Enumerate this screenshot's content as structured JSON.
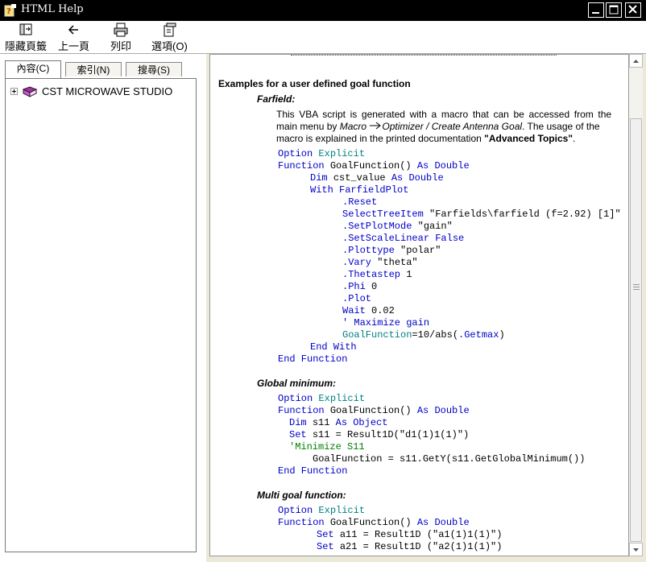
{
  "window": {
    "title": "HTML Help"
  },
  "toolbar": {
    "hide_tabs": "隱藏頁籤",
    "back": "上一頁",
    "print": "列印",
    "options": "選項(O)"
  },
  "tabs": {
    "contents": "內容(C)",
    "index": "索引(N)",
    "search": "搜尋(S)"
  },
  "tree": {
    "root": "CST MICROWAVE STUDIO"
  },
  "doc": {
    "heading": "Examples for a user defined goal function",
    "farfield": {
      "title": "Farfield:",
      "p1": "This VBA script is generated with a macro that can be accessed from the",
      "p2_pre": "main menu by ",
      "p2_macro": "Macro",
      "p2_path": "Optimizer / Create Antenna Goal",
      "p2_post": ". The usage of the",
      "p3_pre": "macro is explained in the printed documentation ",
      "p3_bold": "\"Advanced Topics\"",
      "p3_post": ".",
      "code": {
        "option": "Option",
        "explicit": "Explicit",
        "function": "Function",
        "func_name": "GoalFunction()",
        "as": "As",
        "double": "Double",
        "dim": "Dim",
        "cst_value": "cst_value",
        "with": "With",
        "farfieldplot": "FarfieldPlot",
        "reset": ".Reset",
        "selecttreeitem": "SelectTreeItem",
        "selecttreeitem_arg": "\"Farfields\\farfield (f=2.92) [1]\"",
        "setplotmode": ".SetPlotMode",
        "setplotmode_arg": "\"gain\"",
        "setscalelinear": ".SetScaleLinear",
        "false": "False",
        "plottype": ".Plottype",
        "plottype_arg": "\"polar\"",
        "vary": ".Vary",
        "vary_arg": "\"theta\"",
        "thetastep": ".Thetastep",
        "thetastep_arg": "1",
        "phi": ".Phi",
        "phi_arg": "0",
        "plot": ".Plot",
        "wait": "Wait",
        "wait_arg": "0.02",
        "comment": "' Maximize gain",
        "goal_assign": "GoalFunction",
        "goal_expr_a": "=10/abs(",
        "getmax": ".Getmax",
        "goal_expr_b": ")",
        "end_with": "End With",
        "end_function": "End Function"
      }
    },
    "global_min": {
      "title": "Global minimum:",
      "code": {
        "option": "Option",
        "explicit": "Explicit",
        "function": "Function",
        "func_name": "GoalFunction()",
        "as": "As",
        "double": "Double",
        "dim": "Dim",
        "s11": "s11",
        "object": "Object",
        "set": "Set",
        "assign": "s11 = Result1D(\"d1(1)1(1)\")",
        "comment": "'Minimize S11",
        "goal_line": "GoalFunction = s11.GetY(s11.GetGlobalMinimum())",
        "end_function": "End Function"
      }
    },
    "multi_goal": {
      "title": "Multi goal function:",
      "code": {
        "option": "Option",
        "explicit": "Explicit",
        "function": "Function",
        "func_name": "GoalFunction()",
        "as": "As",
        "double": "Double",
        "set": "Set",
        "a11": "a11 = Result1D (\"a1(1)1(1)\")",
        "a21": "a21 = Result1D (\"a2(1)1(1)\")"
      }
    }
  },
  "colors": {
    "keyword": "#0000c8",
    "comment": "#008080",
    "green": "#008000"
  }
}
